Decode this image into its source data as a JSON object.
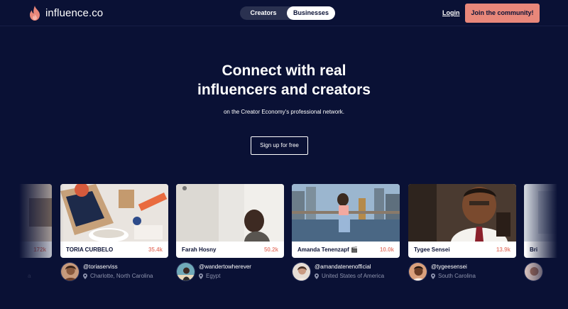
{
  "header": {
    "logo_text": "influence.co",
    "toggle": [
      "Creators",
      "Businesses"
    ],
    "login_label": "Login",
    "join_label": "Join the community!"
  },
  "hero": {
    "title_line1": "Connect with real",
    "title_line2": "influencers and creators",
    "subtitle": "on the Creator Economy's professional network.",
    "cta_label": "Sign up for free"
  },
  "cards": [
    {
      "name": "",
      "count": "172k",
      "handle": "",
      "location": "a"
    },
    {
      "name": "TORIA CURBELO",
      "count": "35.4k",
      "handle": "@toriaserviss",
      "location": "Charlotte, North Carolina"
    },
    {
      "name": "Farah Hosny",
      "count": "50.2k",
      "handle": "@wandertowherever",
      "location": "Egypt"
    },
    {
      "name": "Amanda Tenenzapf 🎬",
      "count": "10.0k",
      "handle": "@amandatenenofficial",
      "location": "United States of America"
    },
    {
      "name": "Tygee Sensei",
      "count": "13.9k",
      "handle": "@tygeesensei",
      "location": "South Carolina"
    },
    {
      "name": "Bri",
      "count": "",
      "handle": "",
      "location": ""
    }
  ],
  "colors": {
    "background": "#0a1135",
    "accent": "#e8877a",
    "card": "#ffffff"
  },
  "icons": [
    "flame-logo-icon",
    "location-pin-icon"
  ]
}
